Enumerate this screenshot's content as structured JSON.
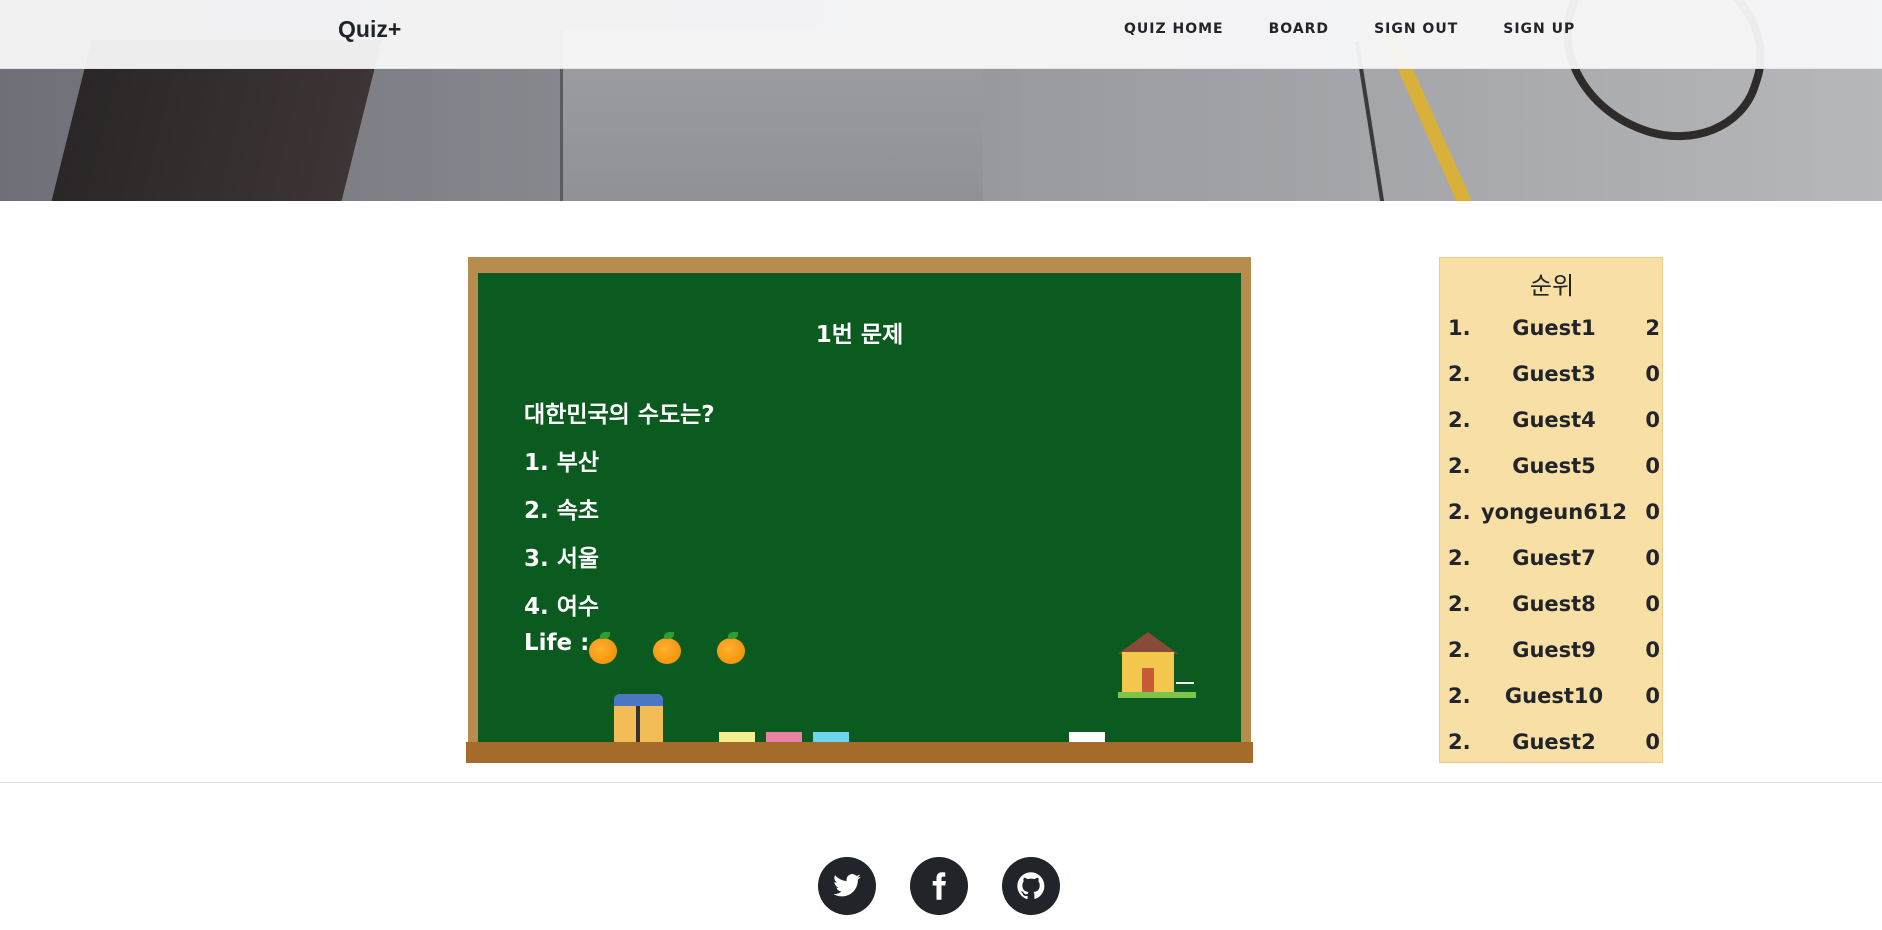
{
  "nav": {
    "brand": "Quiz+",
    "links": [
      "QUIZ HOME",
      "BOARD",
      "SIGN OUT",
      "SIGN UP"
    ]
  },
  "quiz": {
    "title": "1번 문제",
    "question": "대한민국의 수도는?",
    "choices": [
      "1. 부산",
      "2. 속초",
      "3. 서울",
      "4. 여수"
    ],
    "life_label": "Life :",
    "lives": 3
  },
  "ranking": {
    "title": "순위",
    "rows": [
      {
        "pos": "1.",
        "name": "Guest1",
        "score": "2"
      },
      {
        "pos": "2.",
        "name": "Guest3",
        "score": "0"
      },
      {
        "pos": "2.",
        "name": "Guest4",
        "score": "0"
      },
      {
        "pos": "2.",
        "name": "Guest5",
        "score": "0"
      },
      {
        "pos": "2.",
        "name": "yongeun612",
        "score": "0"
      },
      {
        "pos": "2.",
        "name": "Guest7",
        "score": "0"
      },
      {
        "pos": "2.",
        "name": "Guest8",
        "score": "0"
      },
      {
        "pos": "2.",
        "name": "Guest9",
        "score": "0"
      },
      {
        "pos": "2.",
        "name": "Guest10",
        "score": "0"
      },
      {
        "pos": "2.",
        "name": "Guest2",
        "score": "0"
      }
    ]
  },
  "footer": {
    "social_icons": [
      "twitter-icon",
      "facebook-icon",
      "github-icon"
    ]
  },
  "colors": {
    "board": "#0b5a1f",
    "frame": "#b68d4f",
    "ranking_bg": "#f8dfa6",
    "social_bg": "#212529"
  }
}
